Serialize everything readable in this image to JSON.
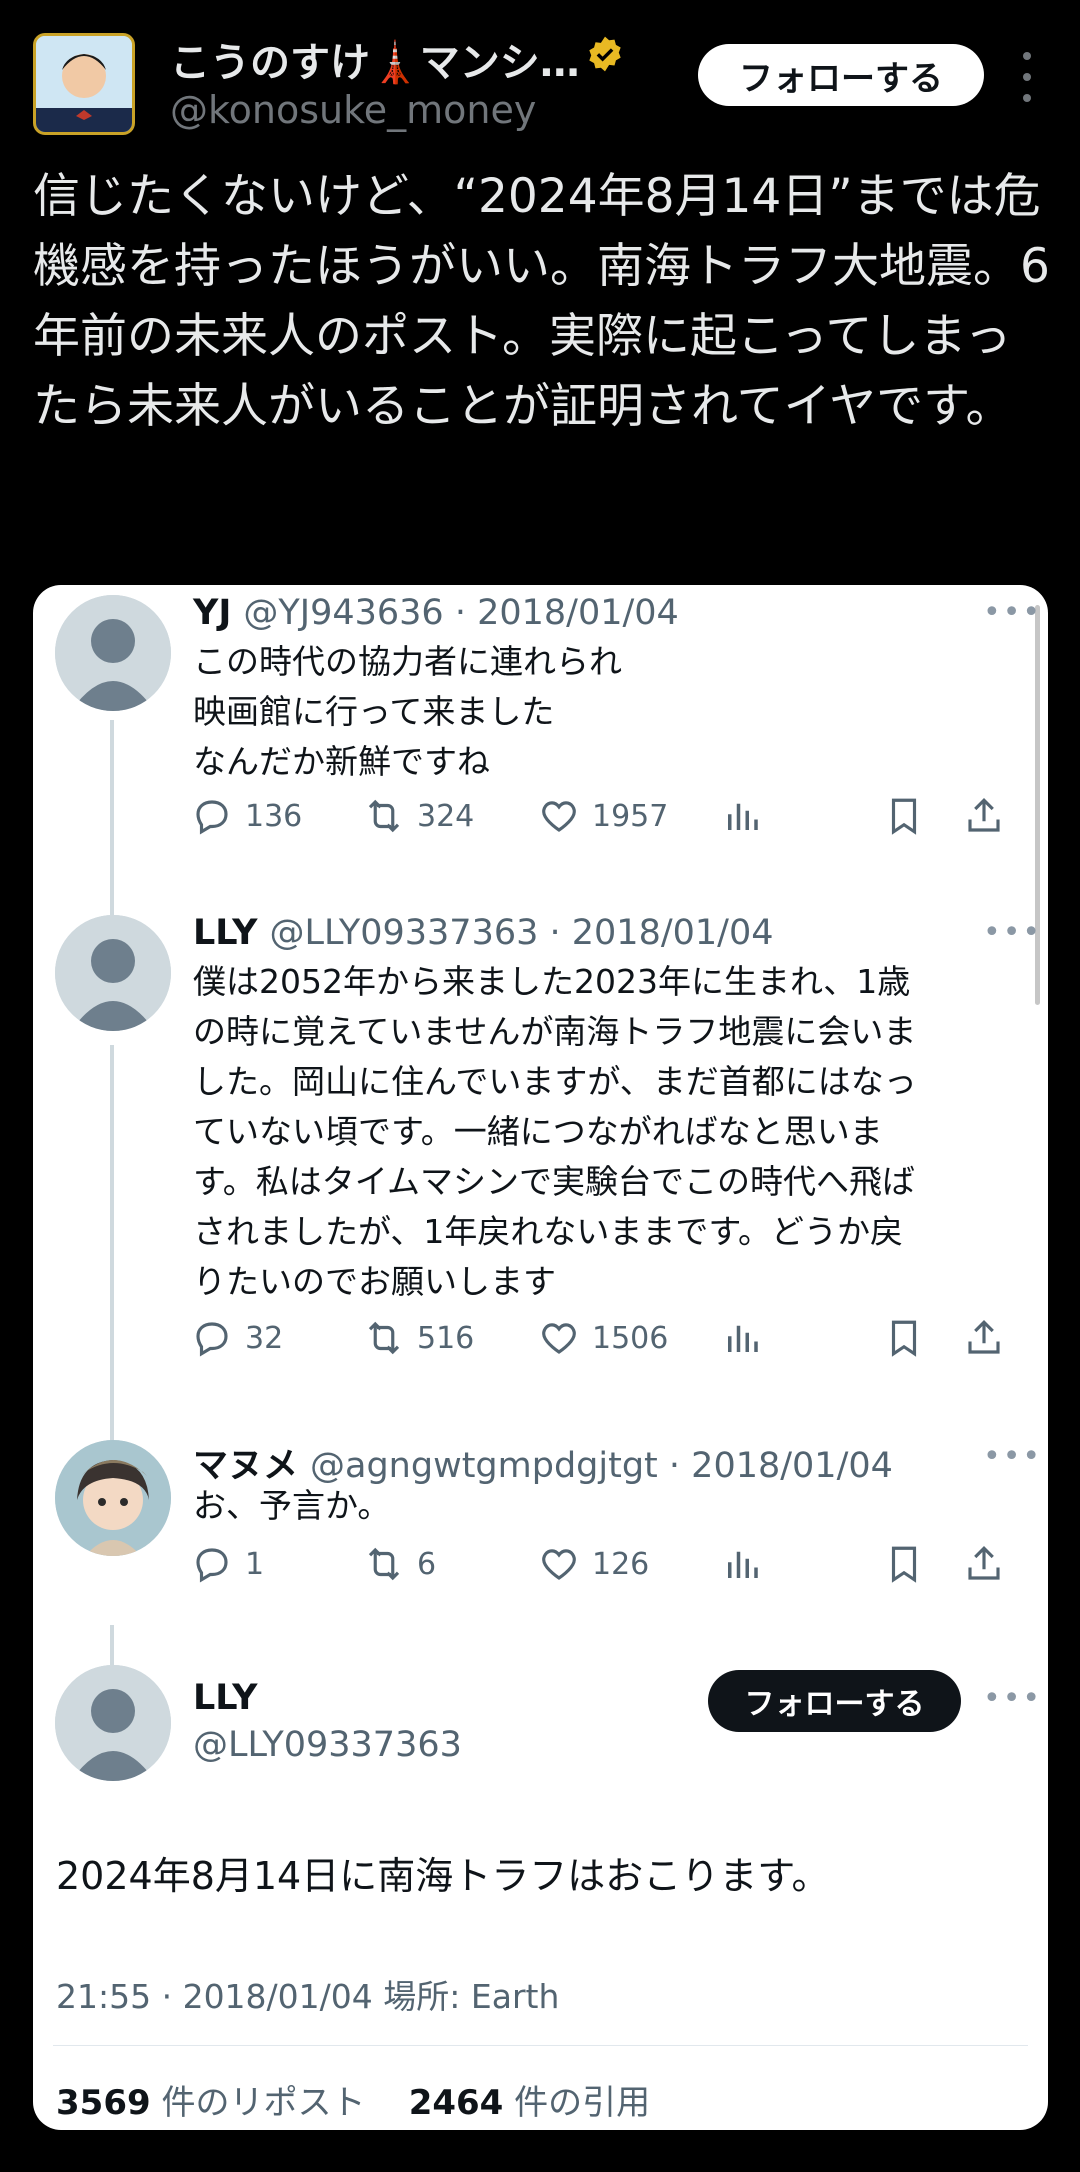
{
  "author": {
    "name": "こうのすけ🗼マンシ…",
    "handle": "@konosuke_money",
    "follow_label": "フォローする"
  },
  "post_text": "信じたくないけど、“2024年8月14日”までは危機感を持ったほうがいい。南海トラフ大地震。6年前の未来人のポスト。実際に起こってしまったら未来人がいることが証明されてイヤです。",
  "thread": [
    {
      "name": "YJ",
      "handle": "@YJ943636",
      "date": "· 2018/01/04",
      "lines": [
        "この時代の協力者に連れられ",
        "映画館に行って来ました",
        "なんだか新鮮ですね"
      ],
      "replies": "136",
      "reposts": "324",
      "likes": "1957"
    },
    {
      "name": "LLY",
      "handle": "@LLY09337363",
      "date": "· 2018/01/04",
      "lines": [
        "僕は2052年から来ました2023年に生まれ、1歳",
        "の時に覚えていませんが南海トラフ地震に会いま",
        "した。岡山に住んでいますが、まだ首都にはなっ",
        "ていない頃です。一緒につながればなと思いま",
        "す。私はタイムマシンで実験台でこの時代へ飛ば",
        "されましたが、1年戻れないままです。どうか戻",
        "りたいのでお願いします"
      ],
      "replies": "32",
      "reposts": "516",
      "likes": "1506"
    },
    {
      "name": "マヌメ",
      "handle": "@agngwtgmpdgjtgt",
      "date": "· 2018/01/04",
      "lines": [
        "お、予言か。"
      ],
      "replies": "1",
      "reposts": "6",
      "likes": "126"
    }
  ],
  "focused": {
    "name": "LLY",
    "handle": "@LLY09337363",
    "follow_label": "フォローする",
    "text": "2024年8月14日に南海トラフはおこります。",
    "meta": "21:55 · 2018/01/04 場所: Earth",
    "reposts_count": "3569",
    "reposts_label": "件のリポスト",
    "quotes_count": "2464",
    "quotes_label": "件の引用"
  }
}
